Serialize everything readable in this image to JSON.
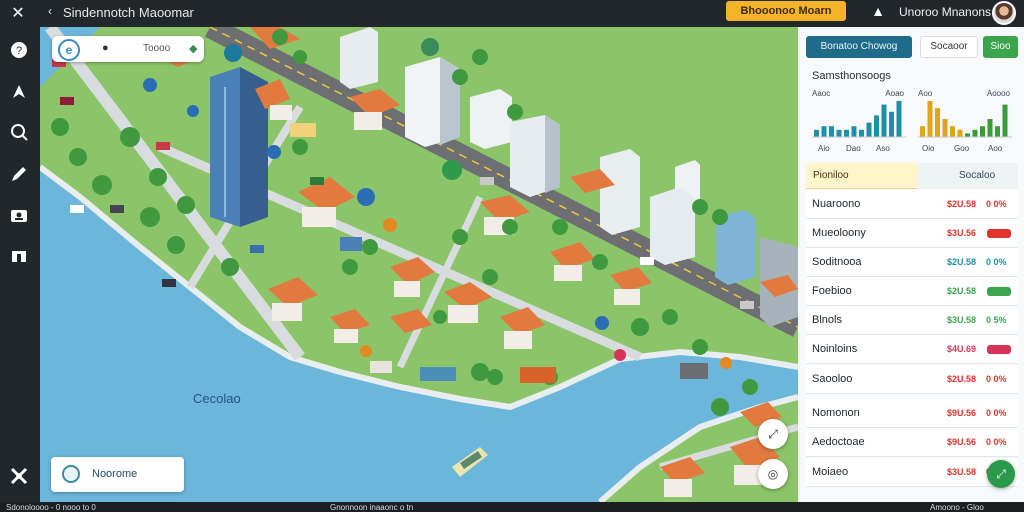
{
  "topbar": {
    "close_icon": "close-icon",
    "back_icon": "chevron-left-icon",
    "title": "Sindennotch Maoomar",
    "cta_label": "Bhooonoo Moarn",
    "up_icon": "arrow-up-icon",
    "user_name": "Unoroo Mnanons",
    "accent_color": "#f5b428"
  },
  "rail": {
    "items": [
      {
        "icon": "info-icon"
      },
      {
        "icon": "location-share-icon"
      },
      {
        "icon": "search-map-icon"
      },
      {
        "icon": "edit-pen-icon"
      },
      {
        "icon": "id-card-icon"
      },
      {
        "icon": "layers-icon"
      },
      {
        "icon": "tools-icon"
      }
    ]
  },
  "map": {
    "search_placeholder": "Toooo",
    "search_logo": "e",
    "ocean_label": "Cecolao",
    "card_label": "Noorome",
    "ctrl_compass": "compass-icon",
    "ctrl_locate": "locate-icon"
  },
  "panel": {
    "tab1": "Bonatoo Chowog",
    "tab2": "Socaoor",
    "tab3": "Sioo",
    "section_title": "Samsthonsoogs",
    "charts": [
      {
        "left_label": "Aaoc",
        "right_label": "Aoao",
        "x_labels": [
          "Aio",
          "Dao",
          "Aso"
        ],
        "values": [
          2,
          3,
          3,
          2,
          2,
          3,
          2,
          4,
          6,
          9,
          7,
          10
        ],
        "color": "#1e8fa8"
      },
      {
        "left_label": "Aoo",
        "right_label": "Aoooo",
        "x_labels": [
          "Oio",
          "Goo",
          "Aoo"
        ],
        "values": [
          3,
          10,
          8,
          5,
          3,
          2,
          1,
          2,
          3,
          5,
          3,
          9
        ],
        "colors": [
          "#e0a41c",
          "#3a9d3a"
        ]
      }
    ],
    "table_header": [
      "Pioniloo",
      "Socaloo"
    ],
    "rows": [
      {
        "name": "Nuaroono",
        "value": "$2U.58",
        "indicator": "pct",
        "pct": "0 0%",
        "color": "#e0342c"
      },
      {
        "name": "Mueoloony",
        "value": "$3U.56",
        "indicator": "bar",
        "color": "#e0342c"
      },
      {
        "name": "Soditnooa",
        "value": "$2U.58",
        "indicator": "pct",
        "pct": "0 0%",
        "color": "#1e8fa8"
      },
      {
        "name": "Foebioo",
        "value": "$2U.58",
        "indicator": "bar",
        "color": "#3aa54d"
      },
      {
        "name": "Blnols",
        "value": "$3U.58",
        "indicator": "pct",
        "pct": "0 5%",
        "color": "#3aa54d"
      },
      {
        "name": "Noinloins",
        "value": "$4U.69",
        "indicator": "bar",
        "color": "#d8345a"
      },
      {
        "name": "Saooloo",
        "value": "$2U.58",
        "indicator": "pct",
        "pct": "0 0%",
        "color": "#e0342c"
      },
      {
        "name": "Nomonon",
        "value": "$9U.56",
        "indicator": "pct",
        "pct": "0 0%",
        "color": "#e0342c"
      },
      {
        "name": "Aedoctoae",
        "value": "$9U.56",
        "indicator": "pct",
        "pct": "0 0%",
        "color": "#e0342c"
      },
      {
        "name": "Moiaeo",
        "value": "$3U.58",
        "indicator": "pct",
        "pct": "0 0%",
        "color": "#e0342c"
      }
    ],
    "fab_icon": "expand-icon"
  },
  "bottombar": {
    "left": "Sdonoloooo - 0 nooo to 0",
    "mid": "Gnonnoon inaaonc o tn",
    "right": "Amoono - Gloo"
  }
}
